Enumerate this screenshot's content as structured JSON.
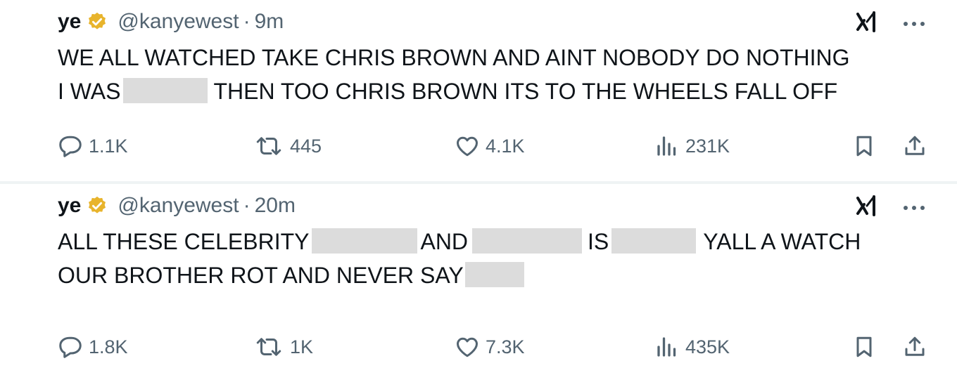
{
  "tweets": [
    {
      "name": "ye",
      "handle": "@kanyewest",
      "separator": "·",
      "time": "9m",
      "lines": [
        [
          "WE ALL WATCHED TAKE CHRIS BROWN AND AINT NOBODY DO NOTHING"
        ],
        [
          "I WAS",
          "THEN TOO  CHRIS BROWN ITS TO THE WHEELS FALL OFF"
        ]
      ],
      "stats": {
        "replies": "1.1K",
        "reposts": "445",
        "likes": "4.1K",
        "views": "231K"
      }
    },
    {
      "name": "ye",
      "handle": "@kanyewest",
      "separator": "·",
      "time": "20m",
      "lines": [
        [
          "ALL THESE CELEBRITY",
          "AND",
          "IS",
          "YALL A WATCH"
        ],
        [
          "OUR BROTHER ROT AND NEVER SAY"
        ]
      ],
      "stats": {
        "replies": "1.8K",
        "reposts": "1K",
        "likes": "7.3K",
        "views": "435K"
      }
    }
  ],
  "icons": {
    "verified": "verified-badge-icon",
    "grok": "grok-icon",
    "more": "more-icon",
    "reply": "reply-icon",
    "repost": "repost-icon",
    "like": "like-icon",
    "views": "views-icon",
    "bookmark": "bookmark-icon",
    "share": "share-icon"
  },
  "colors": {
    "text": "#0f1419",
    "secondary": "#536471",
    "verified": "#e8b42c",
    "redaction": "#dcdcdc",
    "divider": "#eff3f4"
  }
}
